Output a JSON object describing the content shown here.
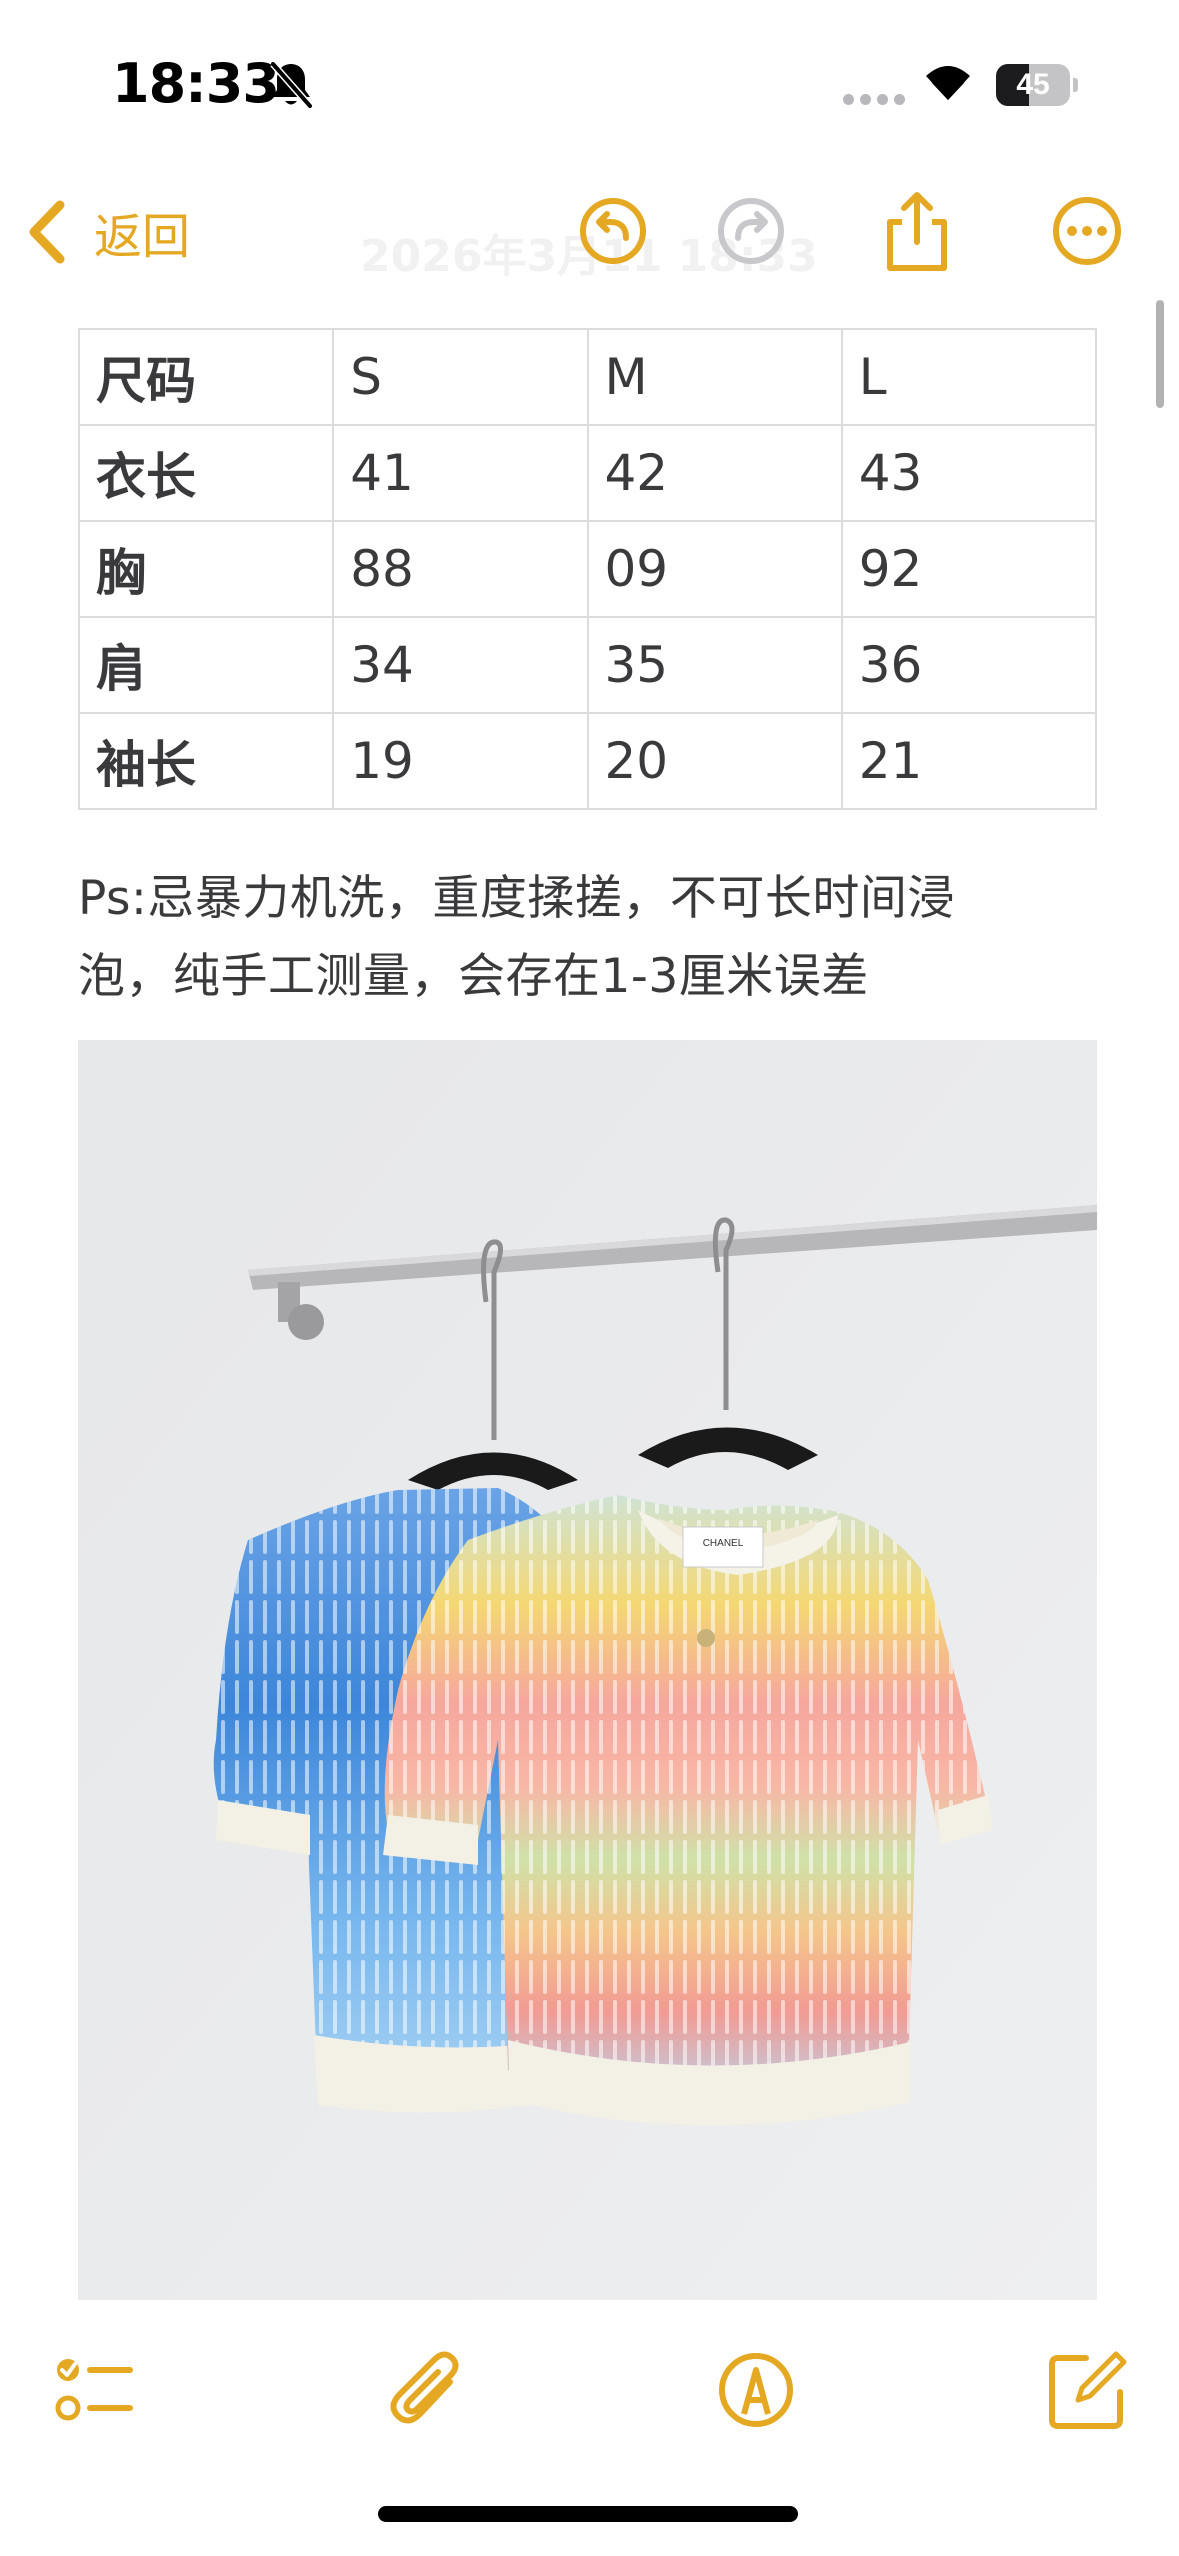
{
  "status_bar": {
    "time": "18:33",
    "battery_level": "45",
    "battery_fraction": 0.45,
    "icons": [
      "bell-slash-icon",
      "cellular-signal-icon",
      "wifi-icon",
      "battery-icon"
    ]
  },
  "nav": {
    "back_label": "返回",
    "faded_title": "2026年3月11 18:33",
    "icons": [
      "undo-icon",
      "redo-icon",
      "share-icon",
      "more-icon"
    ],
    "accent_color": "#e5a823"
  },
  "size_table": {
    "header": [
      "尺码",
      "S",
      "M",
      "L"
    ],
    "rows": [
      [
        "衣长",
        "41",
        "42",
        "43"
      ],
      [
        "胸",
        "88",
        "09",
        "92"
      ],
      [
        "肩",
        "34",
        "35",
        "36"
      ],
      [
        "袖长",
        "19",
        "20",
        "21"
      ]
    ]
  },
  "note": {
    "line1": "Ps:忌暴力机洗，重度揉搓，不可长时间浸",
    "line2": "泡，纯手工测量，会存在1-3厘米误差"
  },
  "photo": {
    "brand_tag_text": "CHANEL",
    "description_icons": [
      "clothes-rail",
      "hanger",
      "knit-top-blue",
      "knit-top-rainbow"
    ]
  },
  "toolbar": {
    "icons": [
      "checklist-icon",
      "paperclip-icon",
      "markup-pen-icon",
      "compose-icon"
    ]
  }
}
